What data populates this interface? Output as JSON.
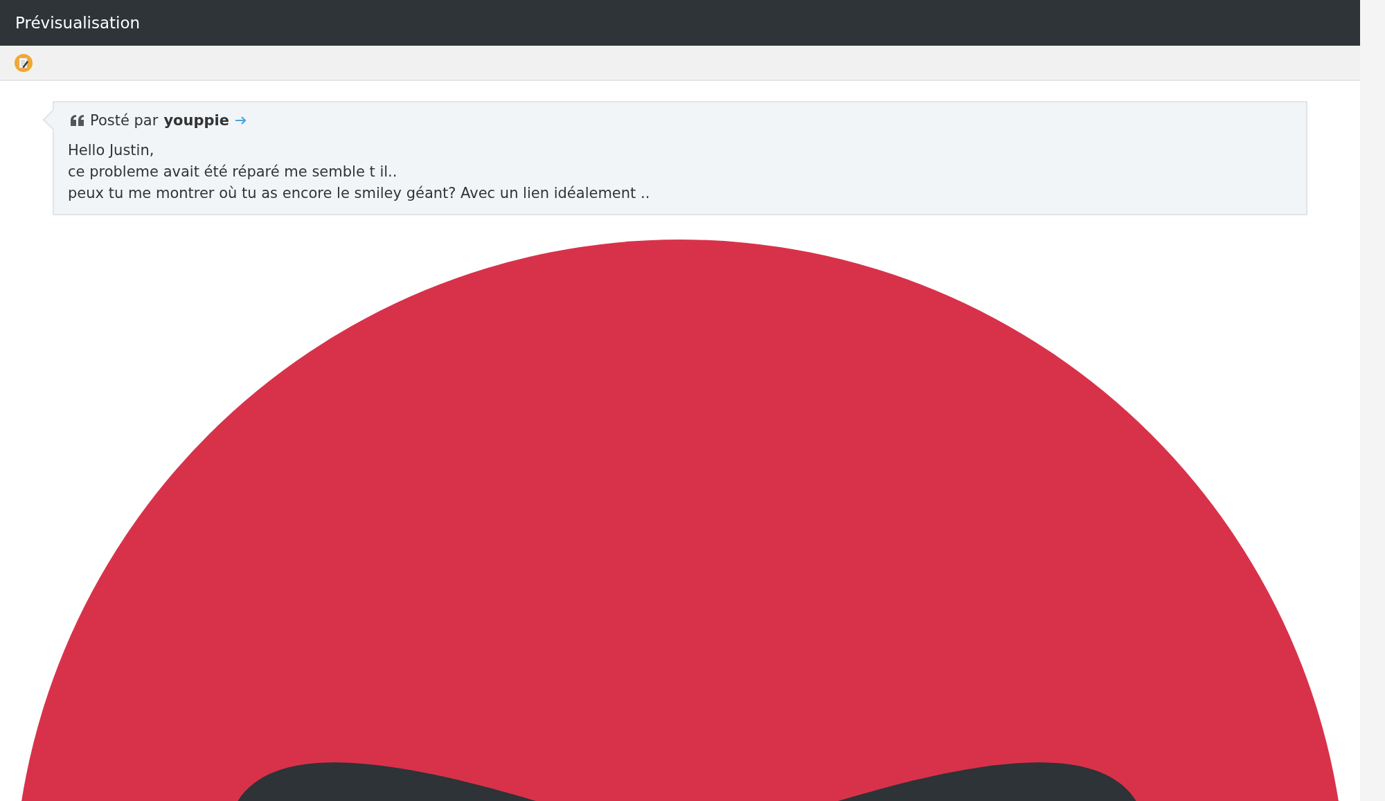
{
  "header": {
    "title": "Prévisualisation"
  },
  "quote": {
    "posted_by": "Posté par",
    "author": "youppie",
    "lines": [
      "Hello Justin,",
      "ce probleme avait été réparé me semble t il..",
      "peux tu me montrer où tu as encore le smiley géant? Avec un lien idéalement .."
    ]
  }
}
